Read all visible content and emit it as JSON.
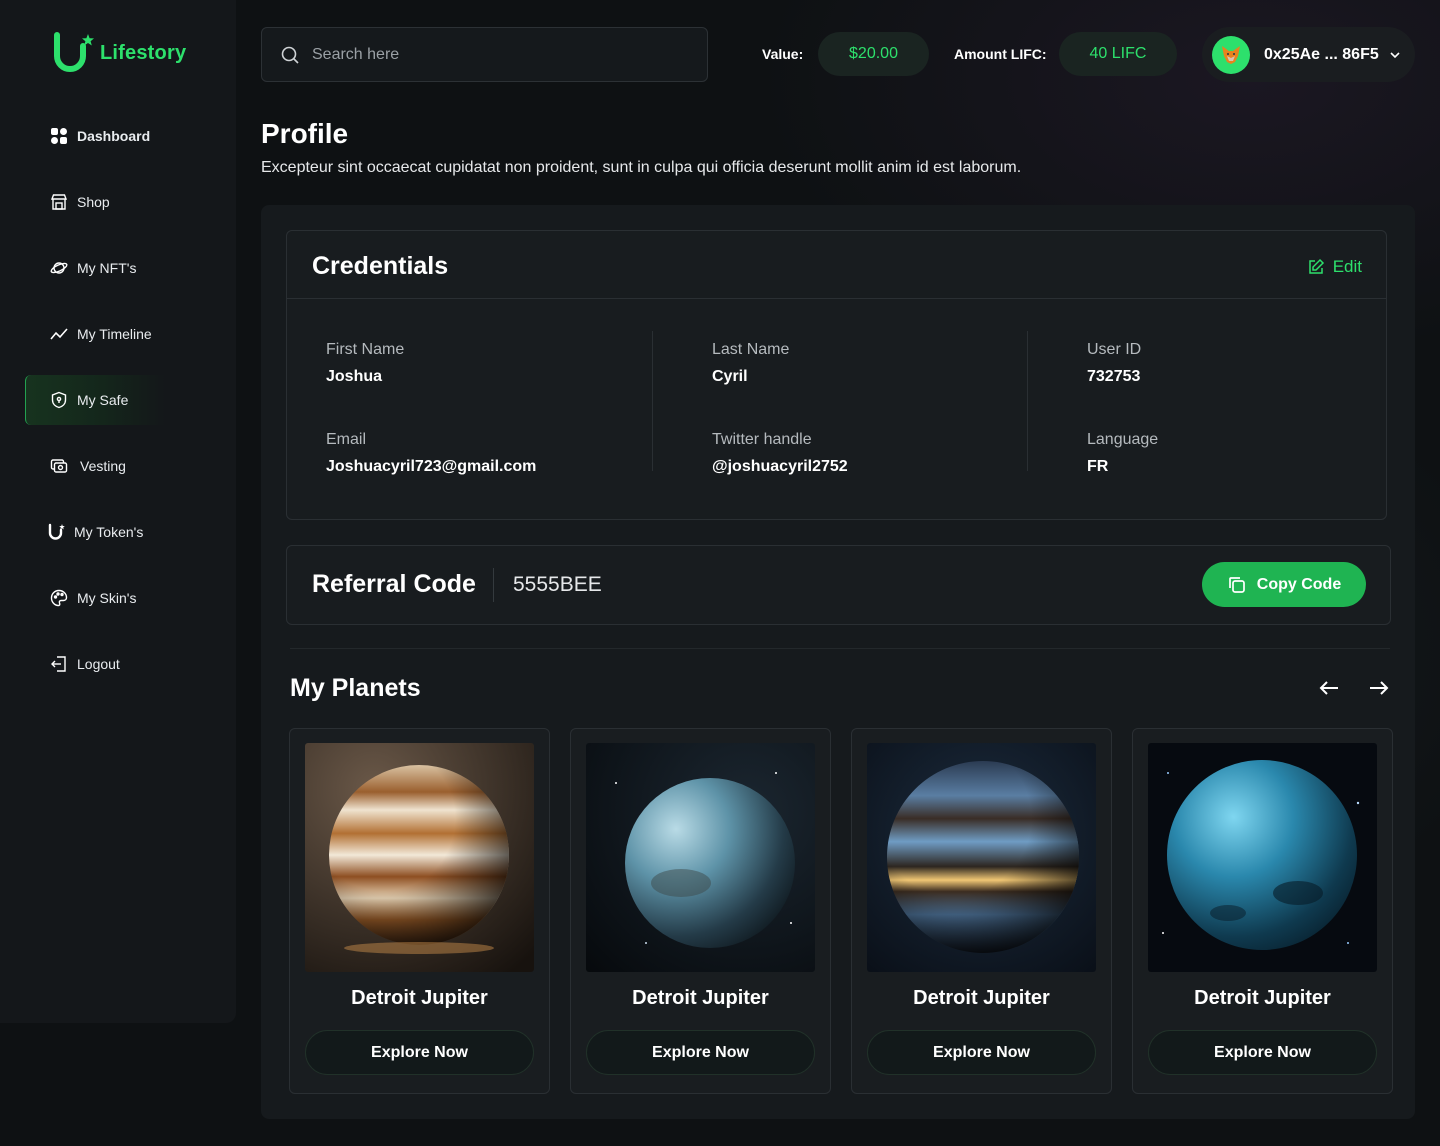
{
  "brand": {
    "name": "Lifestory"
  },
  "sidebar": {
    "items": [
      {
        "label": "Dashboard",
        "icon": "dashboard-icon"
      },
      {
        "label": "Shop",
        "icon": "shop-icon"
      },
      {
        "label": "My NFT's",
        "icon": "planet-icon"
      },
      {
        "label": "My Timeline",
        "icon": "timeline-icon"
      },
      {
        "label": "My Safe",
        "icon": "shield-icon",
        "active": true
      },
      {
        "label": "Vesting",
        "icon": "vesting-icon"
      },
      {
        "label": "My Token's",
        "icon": "token-icon"
      },
      {
        "label": "My Skin's",
        "icon": "palette-icon"
      },
      {
        "label": "Logout",
        "icon": "logout-icon"
      }
    ]
  },
  "header": {
    "search_placeholder": "Search here",
    "value_label": "Value:",
    "value": "$20.00",
    "amount_label": "Amount LIFC:",
    "amount": "40 LIFC",
    "wallet": "0x25Ae ... 86F5"
  },
  "page": {
    "title": "Profile",
    "subtitle": "Excepteur sint occaecat cupidatat non proident, sunt in culpa qui officia deserunt mollit anim id est laborum."
  },
  "credentials": {
    "title": "Credentials",
    "edit_label": "Edit",
    "fields": [
      {
        "label": "First Name",
        "value": "Joshua"
      },
      {
        "label": "Last Name",
        "value": "Cyril"
      },
      {
        "label": "User ID",
        "value": "732753"
      },
      {
        "label": "Email",
        "value": "Joshuacyril723@gmail.com"
      },
      {
        "label": "Twitter handle",
        "value": "@joshuacyril2752"
      },
      {
        "label": "Language",
        "value": "FR"
      }
    ]
  },
  "referral": {
    "title": "Referral Code",
    "code": "5555BEE",
    "copy_label": "Copy Code"
  },
  "planets": {
    "title": "My Planets",
    "items": [
      {
        "name": "Detroit Jupiter",
        "button": "Explore Now"
      },
      {
        "name": "Detroit Jupiter",
        "button": "Explore Now"
      },
      {
        "name": "Detroit Jupiter",
        "button": "Explore Now"
      },
      {
        "name": "Detroit Jupiter",
        "button": "Explore Now"
      }
    ]
  },
  "colors": {
    "accent": "#2de06c",
    "button": "#1fb452",
    "background": "#0e1113"
  }
}
